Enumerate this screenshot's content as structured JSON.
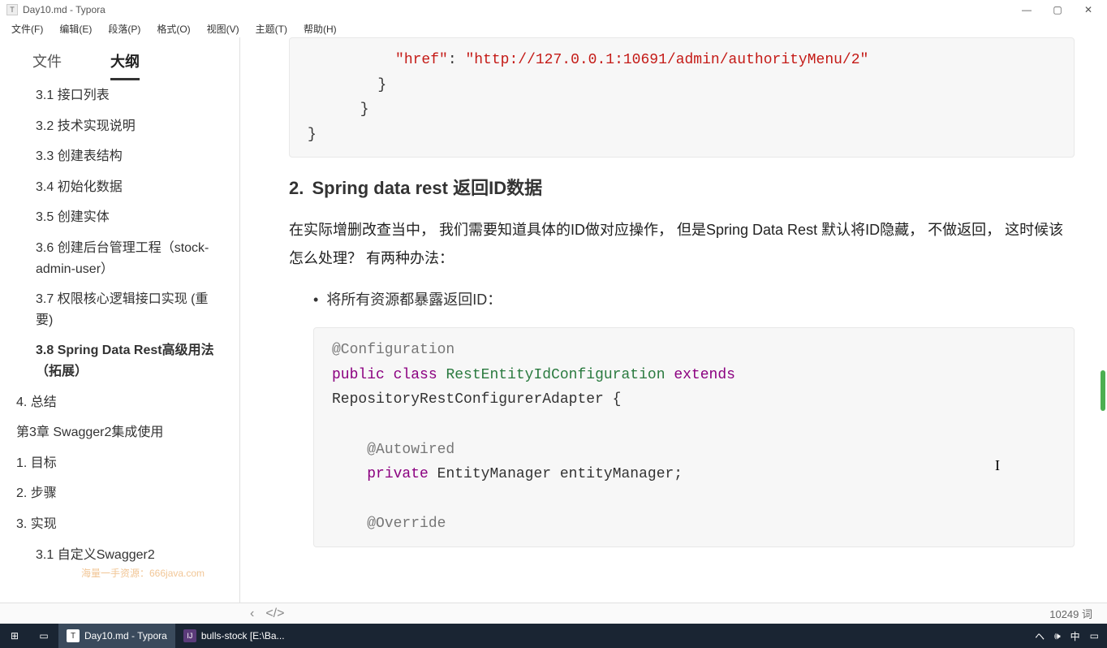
{
  "window": {
    "title": "Day10.md - Typora",
    "icon_letter": "T"
  },
  "menu": {
    "file": "文件(F)",
    "edit": "编辑(E)",
    "paragraph": "段落(P)",
    "format": "格式(O)",
    "view": "视图(V)",
    "theme": "主题(T)",
    "help": "帮助(H)"
  },
  "sidebar": {
    "tab_file": "文件",
    "tab_outline": "大纲",
    "items": [
      {
        "text": "3.1 接口列表",
        "level": 2,
        "cut": true
      },
      {
        "text": "3.2 技术实现说明",
        "level": 2
      },
      {
        "text": "3.3 创建表结构",
        "level": 2
      },
      {
        "text": "3.4 初始化数据",
        "level": 2
      },
      {
        "text": "3.5 创建实体",
        "level": 2
      },
      {
        "text": "3.6 创建后台管理工程（stock-admin-user）",
        "level": 2
      },
      {
        "text": "3.7 权限核心逻辑接口实现 (重要)",
        "level": 2
      },
      {
        "text": "3.8 Spring Data Rest高级用法（拓展）",
        "level": 2,
        "active": true
      },
      {
        "text": "4. 总结",
        "level": 1
      },
      {
        "text": "第3章 Swagger2集成使用",
        "level": 1
      },
      {
        "text": "1. 目标",
        "level": 1
      },
      {
        "text": "2. 步骤",
        "level": 1
      },
      {
        "text": "3. 实现",
        "level": 1
      },
      {
        "text": "3.1 自定义Swagger2",
        "level": 2,
        "cut": true
      }
    ]
  },
  "content": {
    "code1": {
      "indent5": "          ",
      "key_href": "\"href\"",
      "colon": ": ",
      "url": "\"http://127.0.0.1:10691/admin/authorityMenu/2\"",
      "brace4": "        }",
      "brace3": "      }",
      "brace2": "}"
    },
    "heading_num": "2.",
    "heading": "Spring data rest 返回ID数据",
    "para1": "在实际增删改查当中， 我们需要知道具体的ID做对应操作， 但是Spring Data Rest 默认将ID隐藏， 不做返回， 这时候该怎么处理？ 有两种办法：",
    "bullet1": "将所有资源都暴露返回ID：",
    "code2": {
      "ann1": "@Configuration",
      "kw_public": "public",
      "kw_class": "class",
      "cls1": "RestEntityIdConfiguration",
      "kw_extends": "extends",
      "cls2": "RepositoryRestConfigurerAdapter {",
      "ann2": "@Autowired",
      "kw_private": "private",
      "type1": "EntityManager entityManager;",
      "ann3": "@Override"
    }
  },
  "statusbar": {
    "nav_back": "‹",
    "nav_fwd": "</>",
    "wordcount": "10249 词"
  },
  "taskbar": {
    "app1": "Day10.md - Typora",
    "app2": "bulls-stock [E:\\Ba...",
    "ime": "中"
  },
  "watermark": "海量一手资源：666java.com"
}
